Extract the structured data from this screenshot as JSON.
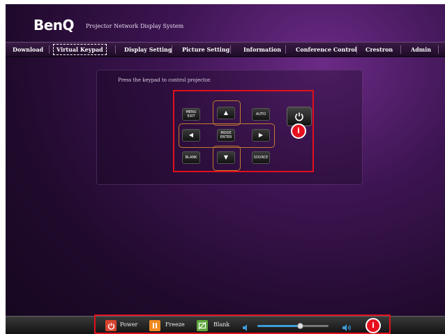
{
  "header": {
    "logo": "BenQ",
    "subtitle": "Projector Network Display System"
  },
  "nav": {
    "items": [
      {
        "label": "Download"
      },
      {
        "label": "Virtual Keypad",
        "selected": true
      },
      {
        "label": "Display Setting"
      },
      {
        "label": "Picture Setting"
      },
      {
        "label": "Information"
      },
      {
        "label": "Conference Control"
      },
      {
        "label": "Crestron"
      },
      {
        "label": "Admin"
      }
    ]
  },
  "keypad": {
    "caption": "Press the keypad to control projector.",
    "menu_exit_line1": "MENU",
    "menu_exit_line2": "EXIT",
    "auto": "AUTO",
    "mode_enter_line1": "MODE",
    "mode_enter_line2": "ENTER",
    "blank": "BLANK",
    "source": "SOURCE",
    "power_icon": "power-icon"
  },
  "callouts": {
    "info_marker": "i"
  },
  "bottombar": {
    "power_label": "Power",
    "freeze_label": "Freeze",
    "blank_label": "Blank",
    "volume_level": 0.6,
    "colors": {
      "power": "#d8432e",
      "freeze": "#f08a22",
      "blank": "#5fa83c",
      "slider": "#3f9bd8"
    }
  }
}
